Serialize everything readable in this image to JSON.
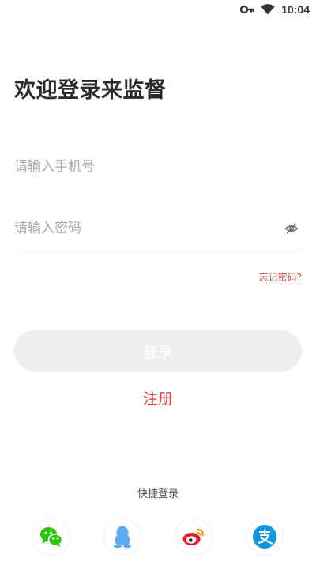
{
  "status_bar": {
    "time": "10:04",
    "icons": [
      "key-icon",
      "wifi-icon"
    ]
  },
  "title": "欢迎登录来监督",
  "phone_input": {
    "placeholder": "请输入手机号",
    "value": ""
  },
  "password_input": {
    "placeholder": "请输入密码",
    "value": "",
    "toggle_icon": "eye-hidden-icon"
  },
  "forgot_password": "忘记密码?",
  "login_button": "登录",
  "register_link": "注册",
  "quick_login": {
    "label": "快捷登录",
    "providers": [
      {
        "name": "wechat",
        "icon": "wechat-icon",
        "color": "#2dc100"
      },
      {
        "name": "qq",
        "icon": "qq-icon",
        "color": "#5eaaf0"
      },
      {
        "name": "weibo",
        "icon": "weibo-icon",
        "color": "#e6162d"
      },
      {
        "name": "alipay",
        "icon": "alipay-icon",
        "color": "#1296db"
      }
    ]
  },
  "colors": {
    "accent_red": "#e04545",
    "forgot_red": "#d9534f",
    "button_disabled_bg": "#eeeeee",
    "placeholder": "#a8a8a8",
    "title": "#2b2b2b"
  }
}
